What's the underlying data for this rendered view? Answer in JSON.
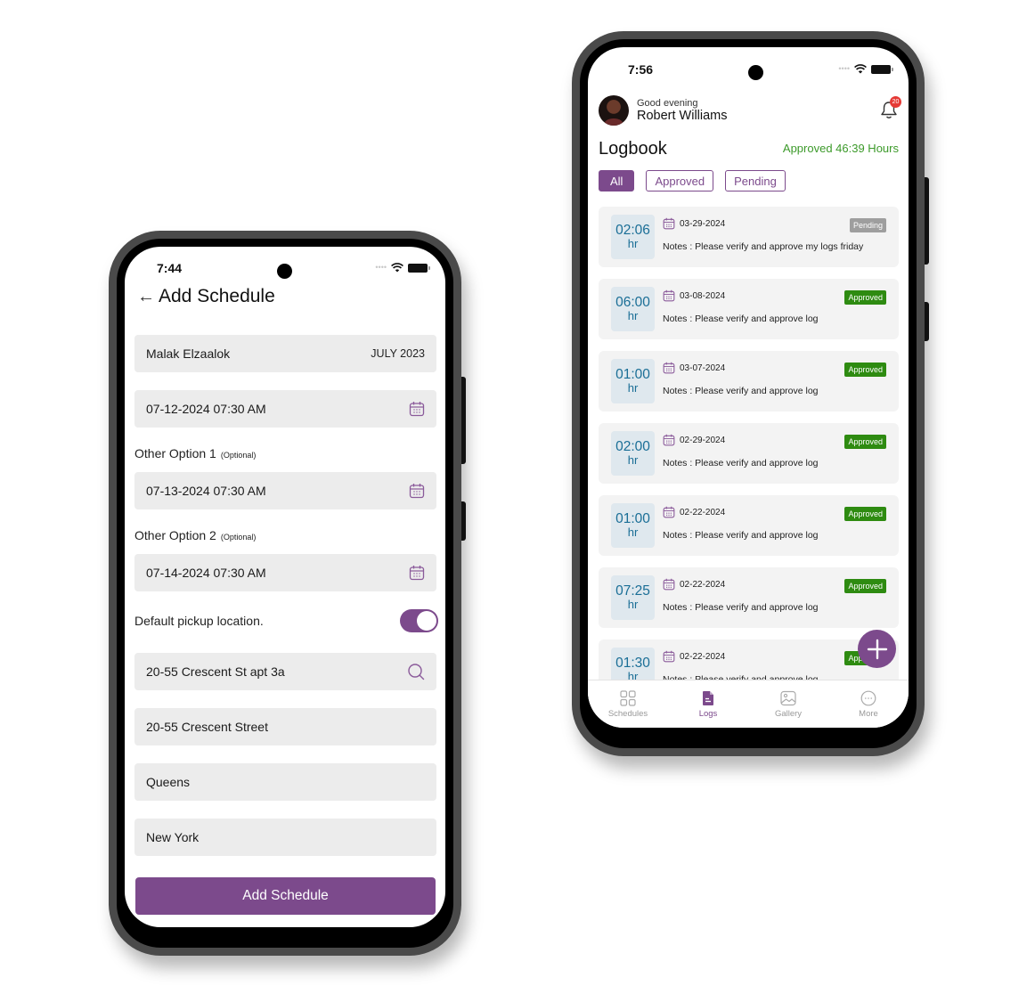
{
  "colors": {
    "brand": "#7c4a8c",
    "approved_green": "#2e8b11",
    "pending_gray": "#9e9e9e",
    "duration_text": "#1a6e96",
    "approved_total_text": "#3c9a2a",
    "badge_red": "#e53935"
  },
  "add_schedule_screen": {
    "status_time": "7:44",
    "title": "Add Schedule",
    "back_icon": "arrow-left-icon",
    "client_field": {
      "name": "Malak Elzaalok",
      "month": "JULY 2023"
    },
    "primary_date": {
      "value": "07-12-2024 07:30 AM",
      "icon": "calendar-icon"
    },
    "option1": {
      "label": "Other Option 1",
      "hint": "(Optional)",
      "value": "07-13-2024 07:30 AM",
      "icon": "calendar-icon"
    },
    "option2": {
      "label": "Other Option 2",
      "hint": "(Optional)",
      "value": "07-14-2024 07:30 AM",
      "icon": "calendar-icon"
    },
    "default_pickup": {
      "label": "Default pickup location.",
      "enabled": true
    },
    "address_search": {
      "value": "20-55 Crescent St apt 3a",
      "icon": "search-icon"
    },
    "street": "20-55 Crescent Street",
    "city": "Queens",
    "state": "New York",
    "submit_label": "Add Schedule"
  },
  "logbook_screen": {
    "status_time": "7:56",
    "greeting": "Good evening",
    "user_name": "Robert Williams",
    "notification_count": "20",
    "title": "Logbook",
    "approved_total": "Approved 46:39 Hours",
    "filters": [
      {
        "label": "All",
        "active": true
      },
      {
        "label": "Approved",
        "active": false
      },
      {
        "label": "Pending",
        "active": false
      }
    ],
    "logs": [
      {
        "duration": "02:06",
        "unit": "hr",
        "date": "03-29-2024",
        "notes": "Notes : Please verify and approve my logs friday",
        "status": "Pending"
      },
      {
        "duration": "06:00",
        "unit": "hr",
        "date": "03-08-2024",
        "notes": "Notes : Please verify and approve log",
        "status": "Approved"
      },
      {
        "duration": "01:00",
        "unit": "hr",
        "date": "03-07-2024",
        "notes": "Notes : Please verify and approve log",
        "status": "Approved"
      },
      {
        "duration": "02:00",
        "unit": "hr",
        "date": "02-29-2024",
        "notes": "Notes : Please verify and approve log",
        "status": "Approved"
      },
      {
        "duration": "01:00",
        "unit": "hr",
        "date": "02-22-2024",
        "notes": "Notes : Please verify and approve log",
        "status": "Approved"
      },
      {
        "duration": "07:25",
        "unit": "hr",
        "date": "02-22-2024",
        "notes": "Notes : Please verify and approve log",
        "status": "Approved"
      },
      {
        "duration": "01:30",
        "unit": "hr",
        "date": "02-22-2024",
        "notes": "Notes : Please verify and approve log",
        "status": "Approved"
      }
    ],
    "fab_icon": "plus-icon",
    "tabs": [
      {
        "label": "Schedules",
        "icon": "grid-icon",
        "active": false
      },
      {
        "label": "Logs",
        "icon": "document-icon",
        "active": true
      },
      {
        "label": "Gallery",
        "icon": "image-icon",
        "active": false
      },
      {
        "label": "More",
        "icon": "more-dots-icon",
        "active": false
      }
    ]
  }
}
